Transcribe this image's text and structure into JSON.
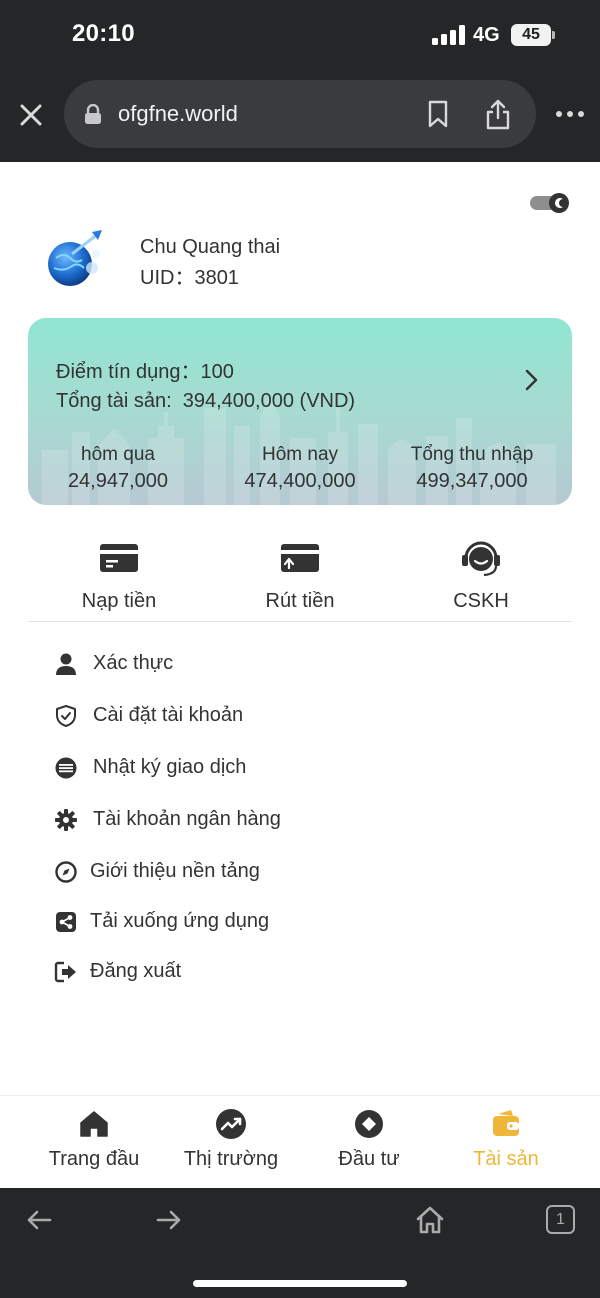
{
  "status_bar": {
    "time": "20:10",
    "network": "4G",
    "battery": "45"
  },
  "browser": {
    "url": "ofgfne.world",
    "tab_count": "1"
  },
  "profile": {
    "name": "Chu Quang thai",
    "uid": "UID：3801"
  },
  "summary_card": {
    "credit_label": "Điểm tín dụng：",
    "credit_value": "100",
    "assets_label": "Tổng tài sản:",
    "assets_value": "394,400,000 (VND)",
    "stats": [
      {
        "label": "hôm qua",
        "value": "24,947,000"
      },
      {
        "label": "Hôm nay",
        "value": "474,400,000"
      },
      {
        "label": "Tổng thu nhập",
        "value": "499,347,000"
      }
    ]
  },
  "actions": [
    {
      "label": "Nạp tiền",
      "icon": "deposit-card-icon"
    },
    {
      "label": "Rút tiền",
      "icon": "withdraw-card-icon"
    },
    {
      "label": "CSKH",
      "icon": "headset-icon"
    }
  ],
  "menu": [
    {
      "label": "Xác thực",
      "icon": "user-icon"
    },
    {
      "label": "Cài đặt tài khoản",
      "icon": "shield-icon"
    },
    {
      "label": "Nhật ký giao dịch",
      "icon": "list-circle-icon"
    },
    {
      "label": "Tài khoản ngân hàng",
      "icon": "gear-icon"
    },
    {
      "label": "Giới thiệu nền tảng",
      "icon": "compass-icon"
    },
    {
      "label": "Tải xuống ứng dụng",
      "icon": "share-icon"
    },
    {
      "label": "Đăng xuất",
      "icon": "logout-icon"
    }
  ],
  "tabbar": [
    {
      "label": "Trang đầu",
      "icon": "home-icon",
      "active": false
    },
    {
      "label": "Thị trường",
      "icon": "trend-icon",
      "active": false
    },
    {
      "label": "Đầu tư",
      "icon": "invest-icon",
      "active": false
    },
    {
      "label": "Tài sản",
      "icon": "wallet-icon",
      "active": true
    }
  ],
  "colors": {
    "accent": "#f0b63a",
    "card_top": "#8fe6d2",
    "card_bottom": "#b6c9d2",
    "browser_chrome": "#252628"
  }
}
